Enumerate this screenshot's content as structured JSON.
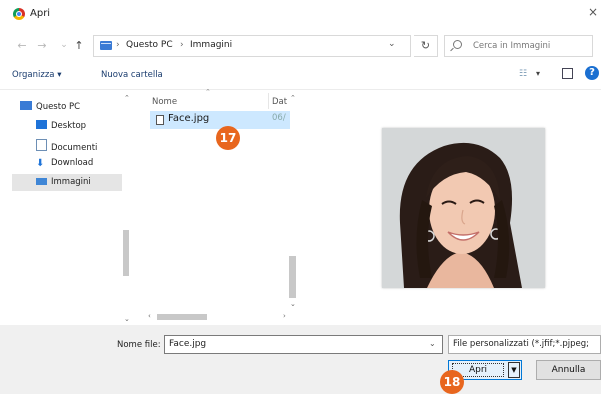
{
  "window": {
    "title": "Apri",
    "close_symbol": "×"
  },
  "nav": {
    "back": "←",
    "forward": "→",
    "recent": "⌄",
    "up": "↑",
    "breadcrumb": [
      "Questo PC",
      "Immagini"
    ],
    "separator": "›",
    "address_dropdown": "⌄",
    "refresh": "↻",
    "search_placeholder": "Cerca in Immagini"
  },
  "commands": {
    "organize": "Organizza ▾",
    "new_folder": "Nuova cartella",
    "view_dropdown": "▾",
    "help": "?"
  },
  "sidebar": {
    "items": [
      {
        "label": "Questo PC",
        "icon": "computer-icon"
      },
      {
        "label": "Desktop",
        "icon": "desktop-icon"
      },
      {
        "label": "Documenti",
        "icon": "documents-icon"
      },
      {
        "label": "Download",
        "icon": "download-icon"
      },
      {
        "label": "Immagini",
        "icon": "pictures-icon",
        "selected": true
      }
    ]
  },
  "file_list": {
    "columns": [
      "Nome",
      "Dat"
    ],
    "files": [
      {
        "name": "Face.jpg",
        "date": "06/"
      }
    ]
  },
  "badges": {
    "step1": "17",
    "step2": "18"
  },
  "footer": {
    "filename_label": "Nome file:",
    "filename_value": "Face.jpg",
    "filter_value": "File personalizzati (*.jfif;*.pjpeg;",
    "open_label": "Apri",
    "cancel_label": "Annulla"
  },
  "colors": {
    "accent": "#0078d7",
    "badge": "#e8661e",
    "selection": "#cde8ff"
  }
}
